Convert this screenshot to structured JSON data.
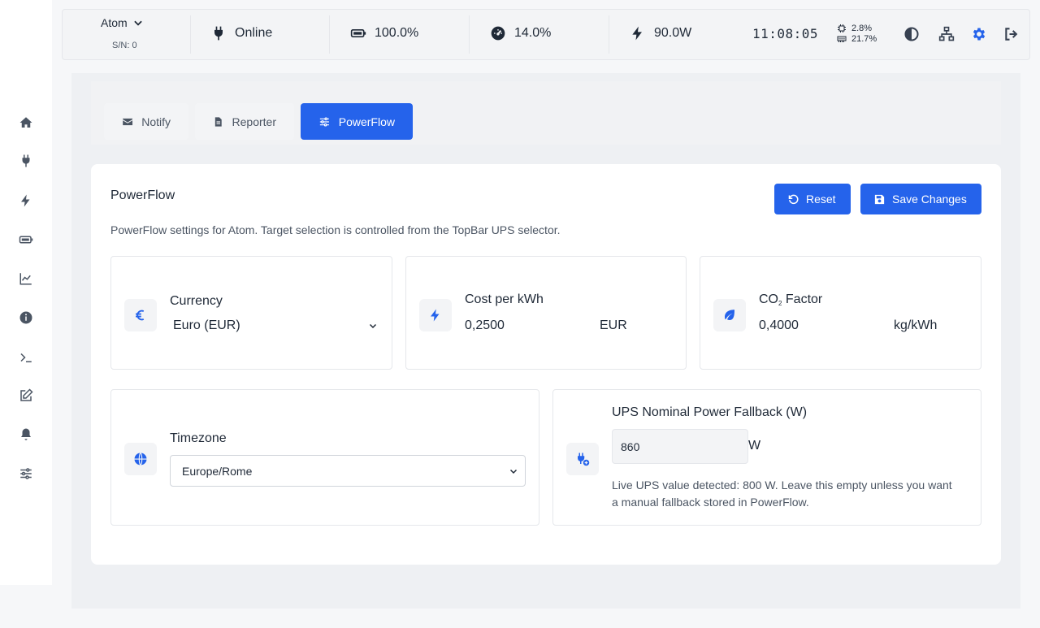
{
  "topbar": {
    "ups_name": "Atom",
    "ups_serial": "S/N: 0",
    "status": "Online",
    "battery": "100.0%",
    "load": "14.0%",
    "power": "90.0W",
    "time": "11:08:05",
    "cpu": "2.8%",
    "mem": "21.7%"
  },
  "sidebar": {
    "items": [
      "home-icon",
      "plug-icon",
      "bolt-icon",
      "battery-icon",
      "chart-line-icon",
      "info-icon",
      "terminal-icon",
      "edit-icon",
      "bell-icon",
      "sliders-icon"
    ]
  },
  "tabs": [
    {
      "label": "Notify"
    },
    {
      "label": "Reporter"
    },
    {
      "label": "PowerFlow",
      "active": true
    }
  ],
  "card": {
    "title": "PowerFlow",
    "description": "PowerFlow settings for Atom. Target selection is controlled from the TopBar UPS selector.",
    "reset_label": "Reset",
    "save_label": "Save Changes"
  },
  "currency": {
    "label": "Currency",
    "value": "Euro (EUR)"
  },
  "cost": {
    "label": "Cost per kWh",
    "value": "0,2500",
    "unit": "EUR"
  },
  "co2": {
    "label_prefix": "CO",
    "label_sub": "2",
    "label_suffix": " Factor",
    "value": "0,4000",
    "unit": "kg/kWh"
  },
  "timezone": {
    "label": "Timezone",
    "value": "Europe/Rome"
  },
  "nominal": {
    "label": "UPS Nominal Power Fallback (W)",
    "value": "860",
    "unit": "W",
    "hint_line1": "Live UPS value detected: 800 W. Leave this empty unless you want",
    "hint_line2": "a manual fallback stored in PowerFlow."
  },
  "colors": {
    "accent": "#2563eb",
    "background": "#f6f7f9",
    "panel": "#eef0f3"
  }
}
